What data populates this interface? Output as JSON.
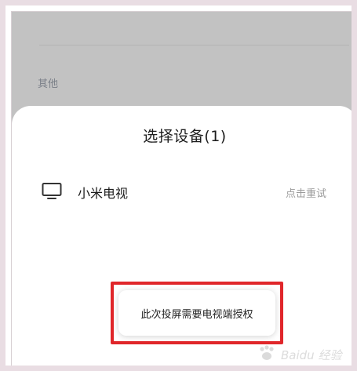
{
  "background": {
    "section_label": "其他"
  },
  "sheet": {
    "title": "选择设备(1)",
    "devices": [
      {
        "name": "小米电视",
        "status": "点击重试",
        "icon": "tv-icon"
      }
    ]
  },
  "toast": {
    "message": "此次投屏需要电视端授权"
  },
  "watermark": {
    "text": "Baidu 经验"
  },
  "colors": {
    "dim_overlay": "#c2c2c2",
    "sheet_bg": "#ffffff",
    "highlight": "#e0262a",
    "status_text": "#9a9a9a"
  }
}
